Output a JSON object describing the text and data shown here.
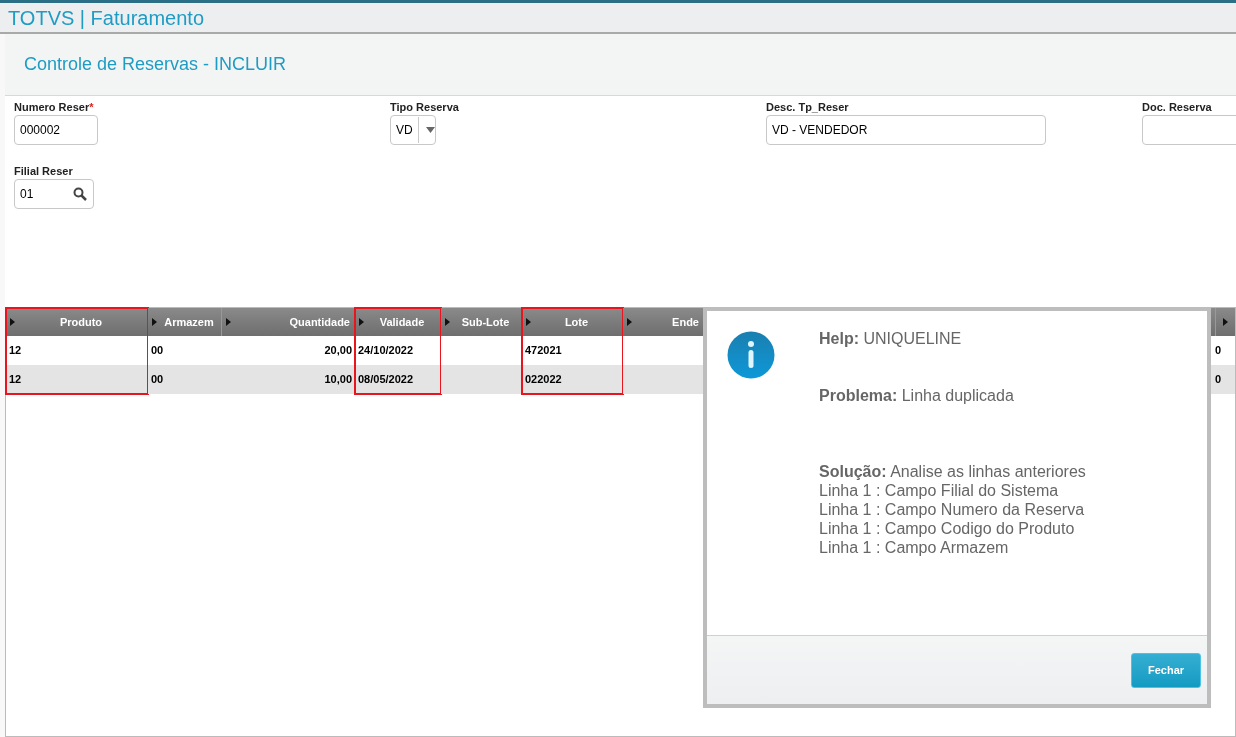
{
  "app_title": "TOTVS | Faturamento",
  "form_title": "Controle de Reservas - INCLUIR",
  "fields": [
    {
      "label": "Numero Reser",
      "required_mark": "*",
      "value": "000002",
      "kind": "text"
    },
    {
      "label": "Tipo Reserva",
      "value": "VD",
      "kind": "select"
    },
    {
      "label": "Desc. Tp_Reser",
      "value": "VD - VENDEDOR",
      "kind": "text"
    },
    {
      "label": "Doc. Reserva",
      "kind": "text"
    },
    {
      "label": "Filial Reser",
      "value": "01",
      "kind": "lookup"
    }
  ],
  "grid": {
    "columns": [
      {
        "label": "Produto",
        "highlighted": true
      },
      {
        "label": "Armazem",
        "highlighted": false
      },
      {
        "label": "Quantidade",
        "highlighted": false
      },
      {
        "label": "Validade",
        "highlighted": true
      },
      {
        "label": "Sub-Lote",
        "highlighted": false
      },
      {
        "label": "Lote",
        "highlighted": true
      },
      {
        "label": "Ende",
        "highlighted": false
      }
    ],
    "rows": [
      [
        "12",
        "00",
        "20,00",
        "24/10/2022",
        "",
        "472021",
        ""
      ],
      [
        "12",
        "00",
        "10,00",
        "08/05/2022",
        "",
        "022022",
        ""
      ]
    ],
    "column_8": [
      "0",
      "0"
    ]
  },
  "dialog": {
    "help_label": "Help:",
    "help": "UNIQUELINE",
    "problem_label": "Problema:",
    "problem": "Linha duplicada",
    "solution_label": "Solução:",
    "solution": "Analise as linhas anteriores",
    "lines": [
      "Linha 1 : Campo Filial do Sistema",
      "Linha 1 : Campo Numero da Reserva",
      "Linha 1 : Campo Codigo do Produto",
      "Linha 1 : Campo Armazem"
    ],
    "button": "Fechar"
  }
}
